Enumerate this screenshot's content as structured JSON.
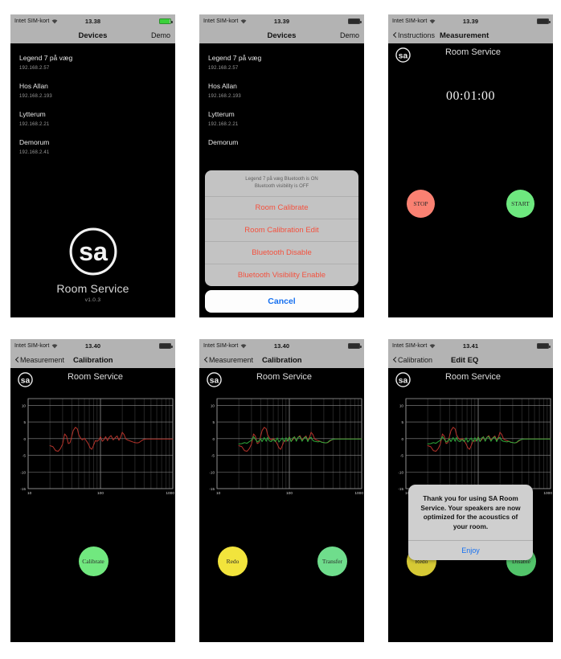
{
  "meta": {
    "carrier": "Intet SIM-kort",
    "wifi_icon": "wifi-icon",
    "battery_icon": "battery-icon",
    "app_name": "Room Service",
    "app_version": "v1.0.3",
    "logo_text": "sa"
  },
  "screens": [
    {
      "id": "devices",
      "status": {
        "carrier": "Intet SIM-kort",
        "time": "13.38",
        "battery": "charging"
      },
      "nav": {
        "title": "Devices",
        "right": "Demo",
        "back": null
      },
      "devices": [
        {
          "name": "Legend 7 på væg",
          "ip": "192.168.2.57"
        },
        {
          "name": "Hos Allan",
          "ip": "192.168.2.193"
        },
        {
          "name": "Lytterum",
          "ip": "192.168.2.21"
        },
        {
          "name": "Demorum",
          "ip": "192.168.2.41"
        }
      ],
      "splash": {
        "title": "Room Service",
        "version": "v1.0.3"
      }
    },
    {
      "id": "devices-actionsheet",
      "status": {
        "carrier": "Intet SIM-kort",
        "time": "13.39",
        "battery": "normal"
      },
      "nav": {
        "title": "Devices",
        "right": "Demo",
        "back": null
      },
      "devices": [
        {
          "name": "Legend 7 på væg",
          "ip": "192.168.2.57"
        },
        {
          "name": "Hos Allan",
          "ip": "192.168.2.193"
        },
        {
          "name": "Lytterum",
          "ip": "192.168.2.21"
        },
        {
          "name": "Demorum",
          "ip": ""
        }
      ],
      "action_sheet": {
        "header_line1": "Legend 7 på væg Bluetooth is ON",
        "header_line2": "Bluetooth visibility is OFF",
        "items": [
          "Room Calibrate",
          "Room Calibration Edit",
          "Bluetooth Disable",
          "Bluetooth Visibility Enable"
        ],
        "cancel": "Cancel"
      }
    },
    {
      "id": "measurement",
      "status": {
        "carrier": "Intet SIM-kort",
        "time": "13.39",
        "battery": "normal"
      },
      "nav": {
        "title": "Measurement",
        "back": "Instructions",
        "right": ""
      },
      "apphead_title": "Room Service",
      "timer": "00:01:00",
      "buttons": {
        "stop": "STOP",
        "start": "START"
      }
    },
    {
      "id": "calibration",
      "status": {
        "carrier": "Intet SIM-kort",
        "time": "13.40",
        "battery": "normal"
      },
      "nav": {
        "title": "Calibration",
        "back": "Measurement",
        "right": ""
      },
      "apphead_title": "Room Service",
      "buttons": {
        "calibrate": "Calibrate"
      }
    },
    {
      "id": "calibration-result",
      "status": {
        "carrier": "Intet SIM-kort",
        "time": "13.40",
        "battery": "normal"
      },
      "nav": {
        "title": "Calibration",
        "back": "Measurement",
        "right": ""
      },
      "apphead_title": "Room Service",
      "buttons": {
        "redo": "Redo",
        "transfer": "Transfer"
      }
    },
    {
      "id": "edit-eq",
      "status": {
        "carrier": "Intet SIM-kort",
        "time": "13.41",
        "battery": "normal"
      },
      "nav": {
        "title": "Edit EQ",
        "back": "Calibration",
        "right": ""
      },
      "apphead_title": "Room Service",
      "buttons": {
        "redo": "Redo",
        "disable": "Disable"
      },
      "alert": {
        "message": "Thank you for using SA Room Service. Your speakers are now optimized for the acoustics of your room.",
        "button": "Enjoy"
      }
    }
  ],
  "chart_data": [
    {
      "chart_id": "calibration-measured",
      "type": "line",
      "title": "",
      "xlabel": "",
      "ylabel": "",
      "xscale": "log",
      "xlim": [
        10,
        1000
      ],
      "ylim": [
        -15,
        12
      ],
      "xticks": [
        10,
        100,
        1000
      ],
      "xtick_labels": [
        "10",
        "100",
        "1000"
      ],
      "yticks": [
        10,
        5,
        0,
        -5,
        -10,
        -15
      ],
      "ytick_labels": [
        "10",
        "5",
        "0",
        "-5",
        "-10",
        "-15"
      ],
      "grid": true,
      "legend": "none",
      "series": [
        {
          "name": "measured",
          "color": "#b5332b",
          "x": [
            20,
            22,
            24,
            26,
            28,
            30,
            32,
            34,
            36,
            38,
            40,
            42,
            45,
            48,
            50,
            53,
            56,
            60,
            64,
            68,
            72,
            76,
            80,
            85,
            90,
            95,
            100,
            106,
            112,
            118,
            125,
            132,
            140,
            150,
            160,
            170,
            180,
            190,
            200,
            212,
            224,
            236,
            250,
            265,
            280,
            300,
            320,
            340,
            360,
            400,
            440,
            500,
            600,
            800,
            1000
          ],
          "y": [
            -2.1,
            -2.4,
            -3.6,
            -3.8,
            -3.0,
            -1.6,
            1.4,
            0.7,
            -1.5,
            -1.2,
            0.6,
            2.4,
            3.4,
            2.9,
            1.2,
            0.2,
            -0.4,
            0.1,
            -0.7,
            -1.6,
            -2.8,
            -3.2,
            -2.1,
            -0.6,
            -0.8,
            -0.4,
            0.6,
            -0.8,
            -0.3,
            0.6,
            -0.6,
            0.4,
            0.9,
            -0.4,
            0.3,
            0.8,
            -0.5,
            0.4,
            1.9,
            1.2,
            -0.1,
            -0.4,
            -0.6,
            -0.8,
            -1.0,
            -1.2,
            -1.3,
            -1.2,
            -0.8,
            -0.2,
            -0.1,
            -0.1,
            -0.1,
            -0.1,
            -0.1
          ]
        }
      ]
    },
    {
      "chart_id": "calibration-corrected",
      "type": "line",
      "title": "",
      "xlabel": "",
      "ylabel": "",
      "xscale": "log",
      "xlim": [
        10,
        1000
      ],
      "ylim": [
        -15,
        12
      ],
      "xticks": [
        10,
        100,
        1000
      ],
      "xtick_labels": [
        "10",
        "100",
        "1000"
      ],
      "yticks": [
        10,
        5,
        0,
        -5,
        -10,
        -15
      ],
      "ytick_labels": [
        "10",
        "5",
        "0",
        "-5",
        "-10",
        "-15"
      ],
      "grid": true,
      "legend": "none",
      "series": [
        {
          "name": "measured",
          "color": "#b5332b",
          "x": [
            20,
            22,
            24,
            26,
            28,
            30,
            32,
            34,
            36,
            38,
            40,
            42,
            45,
            48,
            50,
            53,
            56,
            60,
            64,
            68,
            72,
            76,
            80,
            85,
            90,
            95,
            100,
            106,
            112,
            118,
            125,
            132,
            140,
            150,
            160,
            170,
            180,
            190,
            200,
            212,
            224,
            236,
            250,
            265,
            280,
            300,
            320,
            340,
            360,
            400,
            440,
            500,
            600,
            800,
            1000
          ],
          "y": [
            -2.1,
            -2.4,
            -3.6,
            -3.8,
            -3.0,
            -1.6,
            1.4,
            0.7,
            -1.5,
            -1.2,
            0.6,
            2.4,
            3.4,
            2.9,
            1.2,
            0.2,
            -0.4,
            0.1,
            -0.7,
            -1.6,
            -2.8,
            -3.2,
            -2.1,
            -0.6,
            -0.8,
            -0.4,
            0.6,
            -0.8,
            -0.3,
            0.6,
            -0.6,
            0.4,
            0.9,
            -0.4,
            0.3,
            0.8,
            -0.5,
            0.4,
            1.9,
            1.2,
            -0.1,
            -0.4,
            -0.6,
            -0.8,
            -1.0,
            -1.2,
            -1.3,
            -1.2,
            -0.8,
            -0.2,
            -0.1,
            -0.1,
            -0.1,
            -0.1,
            -0.1
          ]
        },
        {
          "name": "corrected",
          "color": "#2ea83a",
          "x": [
            20,
            22,
            24,
            26,
            28,
            30,
            32,
            34,
            36,
            38,
            40,
            42,
            45,
            48,
            50,
            53,
            56,
            60,
            64,
            68,
            72,
            76,
            80,
            85,
            90,
            95,
            100,
            106,
            112,
            118,
            125,
            132,
            140,
            150,
            160,
            170,
            180,
            190,
            200,
            212,
            224,
            236,
            250,
            265,
            280,
            300,
            320,
            340,
            360,
            400,
            440,
            500,
            600,
            800,
            1000
          ],
          "y": [
            -1.6,
            -1.5,
            -1.2,
            -1.4,
            -0.9,
            -0.5,
            0.6,
            -0.2,
            -1.0,
            -0.7,
            0.0,
            -0.9,
            0.3,
            -0.8,
            0.4,
            -0.7,
            -0.9,
            -0.2,
            -0.9,
            0.2,
            -1.0,
            -0.4,
            0.2,
            -0.9,
            0.3,
            -0.8,
            0.5,
            -0.9,
            0.2,
            0.5,
            -0.8,
            0.4,
            0.6,
            -0.8,
            0.2,
            0.5,
            -0.9,
            0.1,
            0.4,
            -0.6,
            -0.8,
            -0.9,
            -1.0,
            -0.8,
            -1.1,
            -1.2,
            -1.3,
            -1.1,
            -0.6,
            -0.2,
            -0.1,
            -0.1,
            -0.1,
            -0.1,
            -0.1
          ]
        }
      ]
    },
    {
      "chart_id": "edit-eq",
      "type": "line",
      "title": "",
      "xlabel": "",
      "ylabel": "",
      "xscale": "log",
      "xlim": [
        10,
        1000
      ],
      "ylim": [
        -15,
        12
      ],
      "xticks": [
        10,
        100,
        1000
      ],
      "xtick_labels": [
        "10",
        "100",
        "1000"
      ],
      "yticks": [
        10,
        5,
        0,
        -5,
        -10,
        -15
      ],
      "ytick_labels": [
        "10",
        "5",
        "0",
        "-5",
        "-10",
        "-15"
      ],
      "grid": true,
      "legend": "none",
      "series": [
        {
          "name": "measured",
          "color": "#b5332b",
          "x": [
            20,
            22,
            24,
            26,
            28,
            30,
            32,
            34,
            36,
            38,
            40,
            42,
            45,
            48,
            50,
            53,
            56,
            60,
            64,
            68,
            72,
            76,
            80,
            85,
            90,
            95,
            100,
            106,
            112,
            118,
            125,
            132,
            140,
            150,
            160,
            170,
            180,
            190,
            200,
            212,
            224,
            236,
            250,
            265,
            280,
            300,
            320,
            340,
            360,
            400,
            440,
            500,
            600,
            800,
            1000
          ],
          "y": [
            -2.1,
            -2.4,
            -3.6,
            -3.8,
            -3.0,
            -1.6,
            1.4,
            0.7,
            -1.5,
            -1.2,
            0.6,
            2.4,
            3.4,
            2.9,
            1.2,
            0.2,
            -0.4,
            0.1,
            -0.7,
            -1.6,
            -2.8,
            -3.2,
            -2.1,
            -0.6,
            -0.8,
            -0.4,
            0.6,
            -0.8,
            -0.3,
            0.6,
            -0.6,
            0.4,
            0.9,
            -0.4,
            0.3,
            0.8,
            -0.5,
            0.4,
            1.9,
            1.2,
            -0.1,
            -0.4,
            -0.6,
            -0.8,
            -1.0,
            -1.2,
            -1.3,
            -1.2,
            -0.8,
            -0.2,
            -0.1,
            -0.1,
            -0.1,
            -0.1,
            -0.1
          ]
        },
        {
          "name": "corrected",
          "color": "#2ea83a",
          "x": [
            20,
            22,
            24,
            26,
            28,
            30,
            32,
            34,
            36,
            38,
            40,
            42,
            45,
            48,
            50,
            53,
            56,
            60,
            64,
            68,
            72,
            76,
            80,
            85,
            90,
            95,
            100,
            106,
            112,
            118,
            125,
            132,
            140,
            150,
            160,
            170,
            180,
            190,
            200,
            212,
            224,
            236,
            250,
            265,
            280,
            300,
            320,
            340,
            360,
            400,
            440,
            500,
            600,
            800,
            1000
          ],
          "y": [
            -1.6,
            -1.5,
            -1.2,
            -1.4,
            -0.9,
            -0.5,
            0.6,
            -0.2,
            -1.0,
            -0.7,
            0.0,
            -0.9,
            0.3,
            -0.8,
            0.4,
            -0.7,
            -0.9,
            -0.2,
            -0.9,
            0.2,
            -1.0,
            -0.4,
            0.2,
            -0.9,
            0.3,
            -0.8,
            0.5,
            -0.9,
            0.2,
            0.5,
            -0.8,
            0.4,
            0.6,
            -0.8,
            0.2,
            0.5,
            -0.9,
            0.1,
            0.4,
            -0.6,
            -0.8,
            -0.9,
            -1.0,
            -0.8,
            -1.1,
            -1.2,
            -1.3,
            -1.1,
            -0.6,
            -0.2,
            -0.1,
            -0.1,
            -0.1,
            -0.1,
            -0.1
          ]
        }
      ]
    }
  ]
}
